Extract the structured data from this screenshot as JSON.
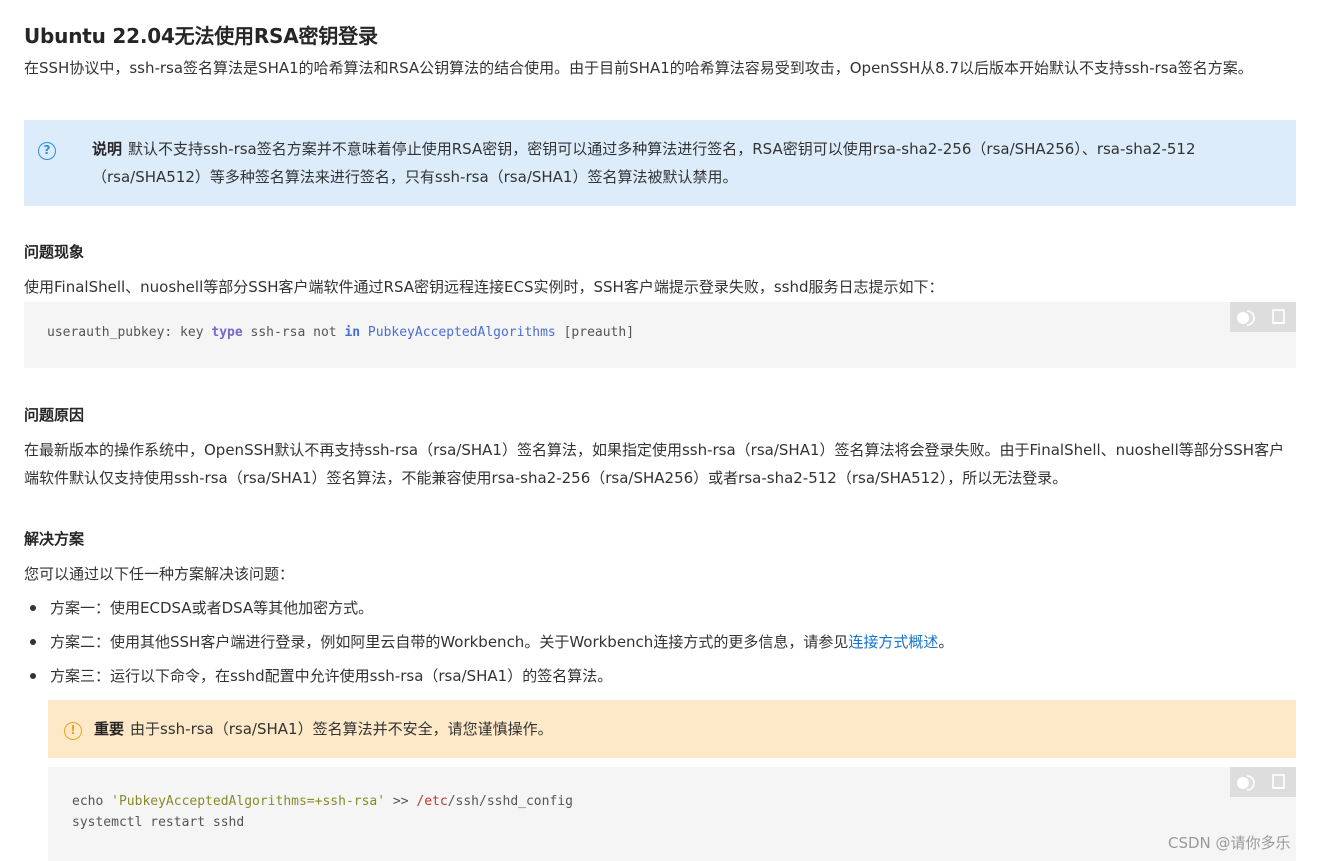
{
  "title": "Ubuntu 22.04无法使用RSA密钥登录",
  "intro": "在SSH协议中，ssh-rsa签名算法是SHA1的哈希算法和RSA公钥算法的结合使用。由于目前SHA1的哈希算法容易受到攻击，OpenSSH从8.7以后版本开始默认不支持ssh-rsa签名方案。",
  "note": {
    "icon": "question-circle-icon",
    "title": "说明",
    "text": "默认不支持ssh-rsa签名方案并不意味着停止使用RSA密钥，密钥可以通过多种算法进行签名，RSA密钥可以使用rsa-sha2-256（rsa/SHA256）、rsa-sha2-512（rsa/SHA512）等多种签名算法来进行签名，只有ssh-rsa（rsa/SHA1）签名算法被默认禁用。"
  },
  "symptom": {
    "heading": "问题现象",
    "text": "使用FinalShell、nuoshell等部分SSH客户端软件通过RSA密钥远程连接ECS实例时，SSH客户端提示登录失败，sshd服务日志提示如下：",
    "code": {
      "p1": "userauth_pubkey: key ",
      "kw_type": "type",
      "p2": " ssh-rsa not ",
      "kw_in": "in",
      "p3": " ",
      "cls": "PubkeyAcceptedAlgorithms",
      "p4": " [preauth]"
    }
  },
  "cause": {
    "heading": "问题原因",
    "text": "在最新版本的操作系统中，OpenSSH默认不再支持ssh-rsa（rsa/SHA1）签名算法，如果指定使用ssh-rsa（rsa/SHA1）签名算法将会登录失败。由于FinalShell、nuoshell等部分SSH客户端软件默认仅支持使用ssh-rsa（rsa/SHA1）签名算法，不能兼容使用rsa-sha2-256（rsa/SHA256）或者rsa-sha2-512（rsa/SHA512），所以无法登录。"
  },
  "solution": {
    "heading": "解决方案",
    "intro": "您可以通过以下任一种方案解决该问题：",
    "items": [
      {
        "text": "方案一：使用ECDSA或者DSA等其他加密方式。"
      },
      {
        "text": "方案二：使用其他SSH客户端进行登录，例如阿里云自带的Workbench。关于Workbench连接方式的更多信息，请参见",
        "link": "连接方式概述",
        "after": "。"
      },
      {
        "text": "方案三：运行以下命令，在sshd配置中允许使用ssh-rsa（rsa/SHA1）的签名算法。"
      }
    ],
    "warning": {
      "icon": "exclamation-circle-icon",
      "title": "重要",
      "text": "由于ssh-rsa（rsa/SHA1）签名算法并不安全，请您谨慎操作。"
    },
    "code": {
      "l1a": "echo ",
      "l1str": "'PubkeyAcceptedAlgorithms=+ssh-rsa'",
      "l1b": " >> ",
      "l1path": "/etc",
      "l1c": "/ssh/sshd_config",
      "l2": "systemctl restart sshd"
    }
  },
  "code_buttons": {
    "run_icon": "toggle-theme-icon",
    "copy_icon": "copy-icon"
  },
  "colors": {
    "note_bg": "#dcecfb",
    "warn_bg": "#fde9c8",
    "code_bg": "#f5f5f5",
    "link": "#1874c9"
  },
  "watermark": "CSDN @请你多乐"
}
